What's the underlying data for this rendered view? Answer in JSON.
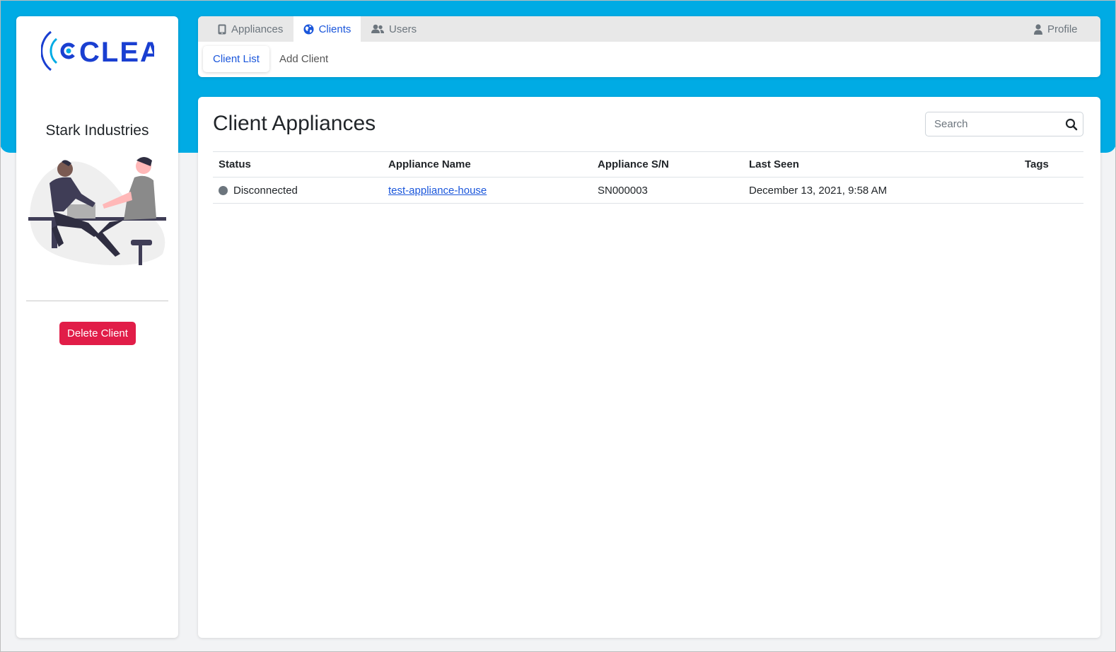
{
  "brand": {
    "logo_text": "CLEA",
    "accent_color": "#00abe4",
    "link_color": "#1a56db",
    "danger_color": "#e11d48"
  },
  "sidebar": {
    "client_name": "Stark Industries",
    "illustration": "handshake-illustration",
    "delete_label": "Delete Client"
  },
  "nav": {
    "tabs": [
      {
        "label": "Appliances",
        "icon": "tablet-icon",
        "active": false
      },
      {
        "label": "Clients",
        "icon": "globe-icon",
        "active": true
      },
      {
        "label": "Users",
        "icon": "users-icon",
        "active": false
      }
    ],
    "profile": {
      "label": "Profile",
      "icon": "user-icon"
    },
    "subtabs": [
      {
        "label": "Client List",
        "active": true
      },
      {
        "label": "Add Client",
        "active": false
      }
    ]
  },
  "main": {
    "title": "Client Appliances",
    "search": {
      "placeholder": "Search",
      "value": "",
      "icon": "search-icon"
    },
    "table": {
      "columns": [
        "Status",
        "Appliance Name",
        "Appliance S/N",
        "Last Seen",
        "Tags"
      ],
      "rows": [
        {
          "status": "Disconnected",
          "status_color": "#6c757d",
          "name": "test-appliance-house",
          "serial": "SN000003",
          "last_seen": "December 13, 2021, 9:58 AM",
          "tags": ""
        }
      ]
    }
  }
}
